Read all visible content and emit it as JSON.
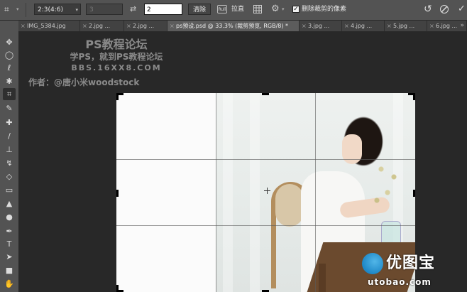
{
  "options_bar": {
    "tool_icon": "crop-icon",
    "ratio": "2:3(4:6)",
    "width_value": "3",
    "swap_icon": "swap-arrows-icon",
    "height_value": "2",
    "clear_label": "清除",
    "straighten_label": "拉直",
    "straighten_icon_text": "Rull",
    "overlay_icon": "grid-icon",
    "settings_icon": "gear-icon",
    "delete_cropped_checked": true,
    "delete_cropped_label": "删除裁剪的像素",
    "reset_icon": "reset-icon",
    "cancel_icon": "cancel-icon",
    "commit_icon": "checkmark-icon"
  },
  "tabs": [
    {
      "label": "IMG_5384.jpg",
      "active": false
    },
    {
      "label": "2.jpg ...",
      "active": false
    },
    {
      "label": "2.jpg ...",
      "active": false
    },
    {
      "label": "ps预设.psd @ 33.3% (裁剪预览, RGB/8) *",
      "active": true
    },
    {
      "label": "3.jpg ...",
      "active": false
    },
    {
      "label": "4.jpg ...",
      "active": false
    },
    {
      "label": "5.jpg ...",
      "active": false
    },
    {
      "label": "6.jpg ...",
      "active": false
    }
  ],
  "tabs_more": "»",
  "tools": [
    "move-tool-icon",
    "marquee-tool-icon",
    "lasso-tool-icon",
    "magic-wand-icon",
    "crop-tool-icon",
    "eyedropper-icon",
    "healing-brush-icon",
    "brush-icon",
    "stamp-icon",
    "history-brush-icon",
    "eraser-icon",
    "gradient-icon",
    "blur-icon",
    "dodge-icon",
    "pen-icon",
    "type-icon",
    "path-select-icon",
    "shape-icon",
    "hand-icon"
  ],
  "watermark": {
    "line1": "PS教程论坛",
    "line2": "学PS，就到PS教程论坛",
    "line3": "BBS.16XX8.COM",
    "line4": "作者：@唐小米woodstock"
  },
  "logo": {
    "name": "优图宝",
    "url": "utobao.com"
  },
  "colors": {
    "panel": "#535353",
    "canvas_bg": "#282828",
    "active_tab": "#5c5c5c",
    "logo_blue": "#1d87c7"
  }
}
